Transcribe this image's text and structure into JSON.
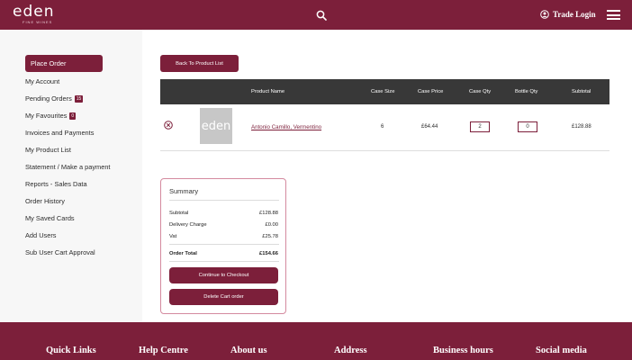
{
  "header": {
    "logo": "eden",
    "logo_sub": "FINE WINES",
    "trade_login": "Trade Login"
  },
  "sidebar": {
    "items": [
      {
        "label": "Place Order",
        "active": true
      },
      {
        "label": "My Account"
      },
      {
        "label": "Pending Orders",
        "badge": "15"
      },
      {
        "label": "My Favourites",
        "badge": "0"
      },
      {
        "label": "Invoices and Payments"
      },
      {
        "label": "My Product List"
      },
      {
        "label": "Statement / Make a payment"
      },
      {
        "label": "Reports - Sales Data"
      },
      {
        "label": "Order History"
      },
      {
        "label": "My Saved Cards"
      },
      {
        "label": "Add Users"
      },
      {
        "label": "Sub User Cart Approval"
      }
    ]
  },
  "main": {
    "back_button": "Back To Product List",
    "columns": [
      "Product Name",
      "Case Size",
      "Case Price",
      "Case Qty",
      "Bottle Qty",
      "Subtotal"
    ],
    "rows": [
      {
        "image_text": "eden",
        "name": "Antonio Camillo, Vermentino",
        "case_size": "6",
        "case_price": "£64.44",
        "case_qty": "2",
        "bottle_qty": "0",
        "subtotal": "£128.88"
      }
    ]
  },
  "summary": {
    "title": "Summary",
    "subtotal_label": "Subtotal",
    "subtotal": "£128.88",
    "delivery_label": "Delivery Charge",
    "delivery": "£0.00",
    "vat_label": "Vat",
    "vat": "£25.78",
    "total_label": "Order Total",
    "total": "£154.66",
    "checkout_button": "Continue to Checkout",
    "delete_button": "Delete Cart order"
  },
  "footer": {
    "headings": [
      "Quick Links",
      "Help Centre",
      "About us",
      "Address",
      "Business hours",
      "Social media"
    ]
  },
  "colors": {
    "brand": "#7c1f3a",
    "table_header": "#383838"
  }
}
